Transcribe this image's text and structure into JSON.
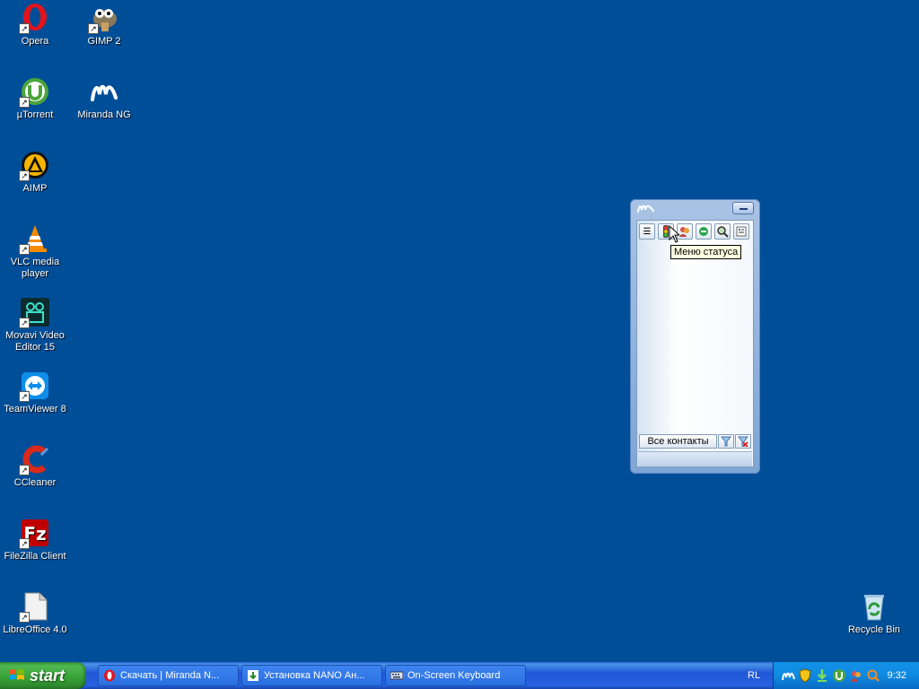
{
  "desktop_icons": [
    {
      "label": "Opera"
    },
    {
      "label": "GIMP 2"
    },
    {
      "label": "µTorrent"
    },
    {
      "label": "Miranda NG"
    },
    {
      "label": "AIMP"
    },
    {
      "label": "VLC media player"
    },
    {
      "label": "Movavi Video Editor 15"
    },
    {
      "label": "TeamViewer 8"
    },
    {
      "label": "CCleaner"
    },
    {
      "label": "FileZilla Client"
    },
    {
      "label": "LibreOffice 4.0"
    },
    {
      "label": "Recycle Bin"
    }
  ],
  "miranda": {
    "tooltip": "Меню статуса",
    "group_button": "Все контакты"
  },
  "taskbar": {
    "start_label": "start",
    "tasks": [
      {
        "label": "Скачать | Miranda N..."
      },
      {
        "label": "Установка NANO Ан..."
      },
      {
        "label": "On-Screen Keyboard"
      }
    ],
    "language": "RL",
    "clock": "9:32"
  },
  "colors": {
    "desktop_background": "#004e98",
    "taskbar_blue": "#2157d7",
    "start_green": "#37a037",
    "tray_blue": "#0f8ae0"
  }
}
